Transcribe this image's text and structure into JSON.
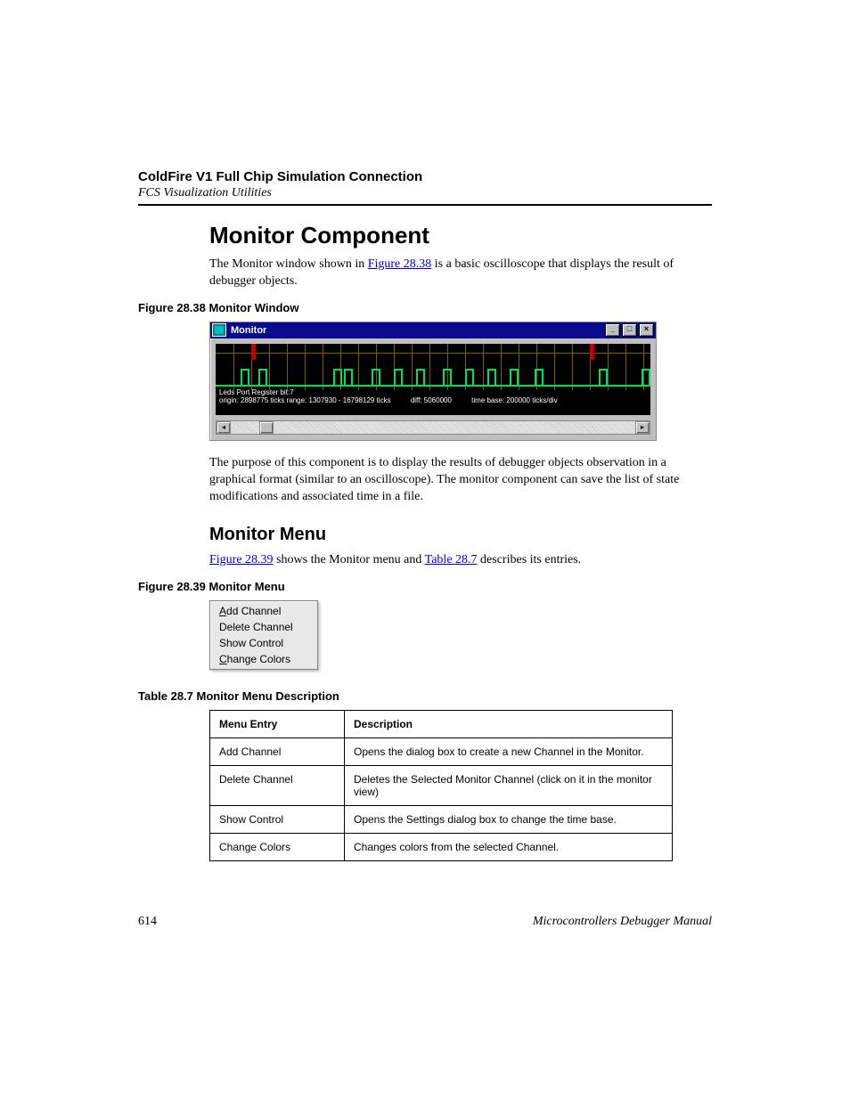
{
  "header": {
    "title_bold": "ColdFire V1 Full Chip Simulation Connection",
    "subtitle_italic": "FCS Visualization Utilities"
  },
  "section": {
    "title": "Monitor Component",
    "intro_pre": "The Monitor window shown in ",
    "intro_link": "Figure 28.38",
    "intro_post": " is a basic oscilloscope that displays the result of debugger objects."
  },
  "figure1": {
    "caption": "Figure 28.38  Monitor Window",
    "window_title": "Monitor",
    "status_line1": "Leds Port  Register bit:7",
    "status_origin": "origin: 2898775 ticks range: 1307930 - 16798129 ticks",
    "status_diff": "diff: 5060000",
    "status_timebase": "time base: 200000 ticks/div"
  },
  "purpose": "The purpose of this component is to display the results of debugger objects observation in a graphical format (similar to an oscilloscope). The monitor component can save the list of state modifications and associated time in a file.",
  "subsection": {
    "title": "Monitor Menu",
    "intro_link1": "Figure 28.39",
    "intro_mid1": " shows the Monitor menu and ",
    "intro_link2": "Table 28.7",
    "intro_mid2": " describes its entries."
  },
  "figure2": {
    "caption": "Figure 28.39  Monitor Menu",
    "items": [
      "Add Channel",
      "Delete Channel",
      "Show Control",
      "Change Colors"
    ]
  },
  "table": {
    "caption": "Table 28.7  Monitor Menu Description",
    "head_entry": "Menu Entry",
    "head_desc": "Description",
    "rows": [
      {
        "entry": "Add Channel",
        "desc": "Opens the dialog box to create a new Channel in the Monitor."
      },
      {
        "entry": "Delete Channel",
        "desc": "Deletes the Selected Monitor Channel (click on it in the monitor view)"
      },
      {
        "entry": "Show Control",
        "desc": "Opens the Settings dialog box to change the time base."
      },
      {
        "entry": "Change Colors",
        "desc": "Changes colors from the selected Channel."
      }
    ]
  },
  "footer": {
    "page": "614",
    "manual": "Microcontrollers Debugger Manual"
  }
}
